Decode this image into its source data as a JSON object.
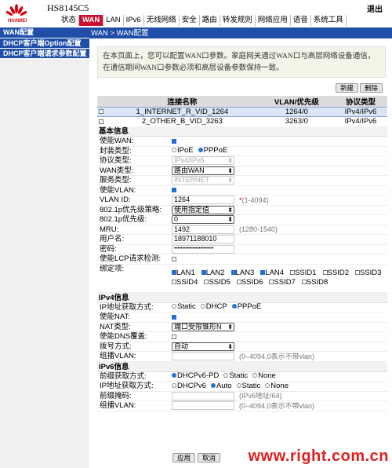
{
  "header": {
    "model": "HS8145C5",
    "logout": "退出",
    "brand": "HUAWEI"
  },
  "nav": [
    "状态",
    "WAN",
    "LAN",
    "IPv6",
    "无线网络",
    "安全",
    "路由",
    "转发规则",
    "网络应用",
    "语音",
    "系统工具"
  ],
  "sidebar": [
    "WAN配置",
    "DHCP客户端Option配置",
    "DHCP客户端请求参数配置"
  ],
  "breadcrumb": "WAN > WAN配置",
  "description": "在本页面上，您可以配置WAN口参数。家庭网关通过WAN口与高层网络设备通信，在通信期间WAN口参数必须和高层设备参数保持一致。",
  "buttons": {
    "new": "新建",
    "delete": "删除",
    "apply": "应用",
    "cancel": "取消"
  },
  "table": {
    "headers": [
      "连接名称",
      "VLAN/优先级",
      "协议类型"
    ],
    "rows": [
      [
        "1_INTERNET_R_VID_1264",
        "1264/0",
        "IPv4/IPv6"
      ],
      [
        "2_OTHER_B_VID_3263",
        "3263/0",
        "IPv4/IPv6"
      ]
    ]
  },
  "basic": {
    "title": "基本信息",
    "enable_wan": "使能WAN:",
    "encap": "封装类型:",
    "encap_opts": [
      "IPoE",
      "PPPoE"
    ],
    "proto": "协议类型:",
    "proto_val": "IPv4/IPv6",
    "wan_type": "WAN类型:",
    "wan_type_val": "路由WAN",
    "service": "服务类型:",
    "service_val": "INTERNET",
    "enable_vlan": "使能VLAN:",
    "vlan_id": "VLAN ID:",
    "vlan_id_val": "1264",
    "vlan_hint": "(1-4094)",
    "p1": "802.1p优先级策略:",
    "p1_val": "使用指定值",
    "p1p": "802.1p优先级:",
    "p1p_val": "0",
    "mru": "MRU:",
    "mru_val": "1492",
    "mru_hint": "(1280-1540)",
    "user": "用户名:",
    "user_val": "18971188010",
    "pwd": "密码:",
    "pwd_val": "••••••••••••••••••••••••",
    "lcp": "使能LCP请求检测:",
    "bind": "绑定项:",
    "bind_opts": [
      "LAN1",
      "LAN2",
      "LAN3",
      "LAN4",
      "SSID1",
      "SSID2",
      "SSID3",
      "SSID4",
      "SSID5",
      "SSID6",
      "SSID7",
      "SSID8"
    ]
  },
  "ipv4": {
    "title": "IPv4信息",
    "mode": "IP地址获取方式:",
    "mode_opts": [
      "Static",
      "DHCP",
      "PPPoE"
    ],
    "nat": "使能NAT:",
    "nat_type": "NAT类型:",
    "nat_type_val": "端口受限锥形N",
    "dns": "使能DNS覆盖:",
    "dial": "拨号方式:",
    "dial_val": "自动",
    "vlan": "组播VLAN:",
    "vlan_hint": "(0–4094,0表示不带vlan)"
  },
  "ipv6": {
    "title": "IPv6信息",
    "prefix": "前缀获取方式:",
    "prefix_opts": [
      "DHCPv6-PD",
      "Static",
      "None"
    ],
    "mode": "IP地址获取方式:",
    "mode_opts": [
      "DHCPv6",
      "Auto",
      "Static",
      "None"
    ],
    "mask": "前缀掩码:",
    "mask_hint": "(IPv6地址/64)",
    "vlan": "组播VLAN:",
    "vlan_hint": "(0–4094,0表示不带vlan)"
  },
  "watermark": "www.right.com.cn"
}
